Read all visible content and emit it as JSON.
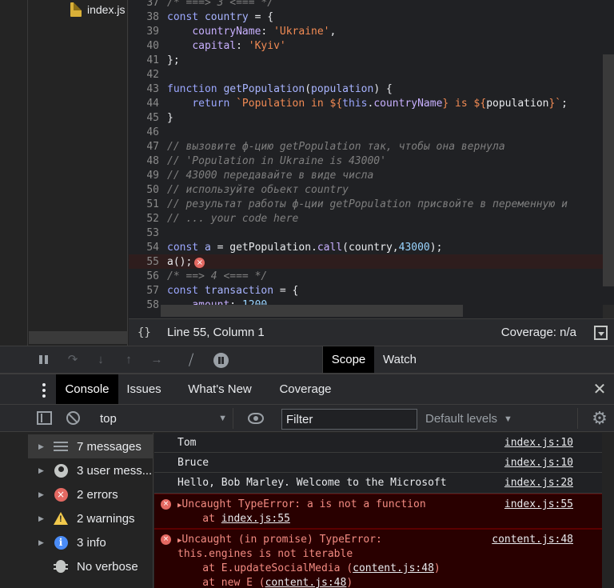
{
  "file_tree": {
    "file_name": "index.js"
  },
  "editor": {
    "lines": [
      {
        "n": "37",
        "html": "<span class='cmt'>/* ===> 3 <=== */</span>"
      },
      {
        "n": "38",
        "html": "<span class='kw'>const</span> <span class='var'>country</span> = {"
      },
      {
        "n": "39",
        "html": "    <span class='prop'>countryName</span>: <span class='str'>'Ukraine'</span>,"
      },
      {
        "n": "40",
        "html": "    <span class='prop'>capital</span>: <span class='str'>'Kyiv'</span>"
      },
      {
        "n": "41",
        "html": "};"
      },
      {
        "n": "42",
        "html": ""
      },
      {
        "n": "43",
        "html": "<span class='kw'>function</span> <span class='var'>getPopulation</span>(<span class='var'>population</span>) {"
      },
      {
        "n": "44",
        "html": "    <span class='kw'>return</span> <span class='str'>`Population in ${</span><span class='kw'>this</span>.<span class='prop'>countryName</span><span class='str'>} is ${</span>population<span class='str'>}`</span>;"
      },
      {
        "n": "45",
        "html": "}"
      },
      {
        "n": "46",
        "html": ""
      },
      {
        "n": "47",
        "html": "<span class='cmt'>// вызовите ф-цию getPopulation так, чтобы она вернула</span>"
      },
      {
        "n": "48",
        "html": "<span class='cmt'>// 'Population in Ukraine is 43000'</span>"
      },
      {
        "n": "49",
        "html": "<span class='cmt'>// 43000 передавайте в виде числа</span>"
      },
      {
        "n": "50",
        "html": "<span class='cmt'>// используйте обьект country</span>"
      },
      {
        "n": "51",
        "html": "<span class='cmt'>// результат работы ф-ции getPopulation присвойте в переменную и</span>"
      },
      {
        "n": "52",
        "html": "<span class='cmt'>// ... your code here</span>"
      },
      {
        "n": "53",
        "html": ""
      },
      {
        "n": "54",
        "html": "<span class='kw'>const</span> <span class='var'>a</span> = getPopulation.<span class='prop'>call</span>(country,<span class='num'>43000</span>);"
      },
      {
        "n": "55",
        "html": "a();<span class='err-circle'>×</span>",
        "error": true
      },
      {
        "n": "56",
        "html": "<span class='cmt'>/* ==> 4 <=== */</span>"
      },
      {
        "n": "57",
        "html": "<span class='kw'>const</span> <span class='var'>transaction</span> = {"
      },
      {
        "n": "58",
        "html": "    <span class='prop'>amount</span>: <span class='num'>1200</span>,"
      }
    ]
  },
  "status_bar": {
    "braces": "{}",
    "position": "Line 55, Column 1",
    "coverage": "Coverage: n/a"
  },
  "debugger": {
    "tab_scope": "Scope",
    "tab_watch": "Watch"
  },
  "drawer": {
    "tabs": [
      "Console",
      "Issues",
      "What's New",
      "Coverage"
    ],
    "close": "✕"
  },
  "console_toolbar": {
    "context": "top",
    "filter_placeholder": "Filter",
    "levels": "Default levels"
  },
  "sidebar": {
    "items": [
      {
        "label": "7 messages",
        "icon": "list-icon"
      },
      {
        "label": "3 user mess...",
        "icon": "user-icon"
      },
      {
        "label": "2 errors",
        "icon": "error-icon"
      },
      {
        "label": "2 warnings",
        "icon": "warning-icon"
      },
      {
        "label": "3 info",
        "icon": "info-icon"
      },
      {
        "label": "No verbose",
        "icon": "bug-icon"
      }
    ]
  },
  "messages": [
    {
      "text": "Tom",
      "src": "index.js:10"
    },
    {
      "text": "Bruce",
      "src": "index.js:10"
    },
    {
      "text": "Hello, Bob Marley. Welcome to the Microsoft",
      "src": "index.js:28"
    },
    {
      "text": "Uncaught TypeError: a is not a function",
      "src": "index.js:55",
      "stack_prefix": "    at ",
      "stack_link": "index.js:55"
    },
    {
      "text": "Uncaught (in promise) TypeError:",
      "text2": "this.engines is not iterable",
      "src": "content.js:48",
      "stack1_prefix": "    at E.updateSocialMedia (",
      "stack1_link": "content.js:48",
      "stack1_suffix": ")",
      "stack2_prefix": "    at new E (",
      "stack2_link": "content.js:48",
      "stack2_suffix": ")"
    }
  ],
  "colors": {
    "background": "#242424",
    "editor_bg": "#202124",
    "error_bg": "#290000",
    "error_text": "#f28b82",
    "active_tab_bg": "#000000"
  }
}
